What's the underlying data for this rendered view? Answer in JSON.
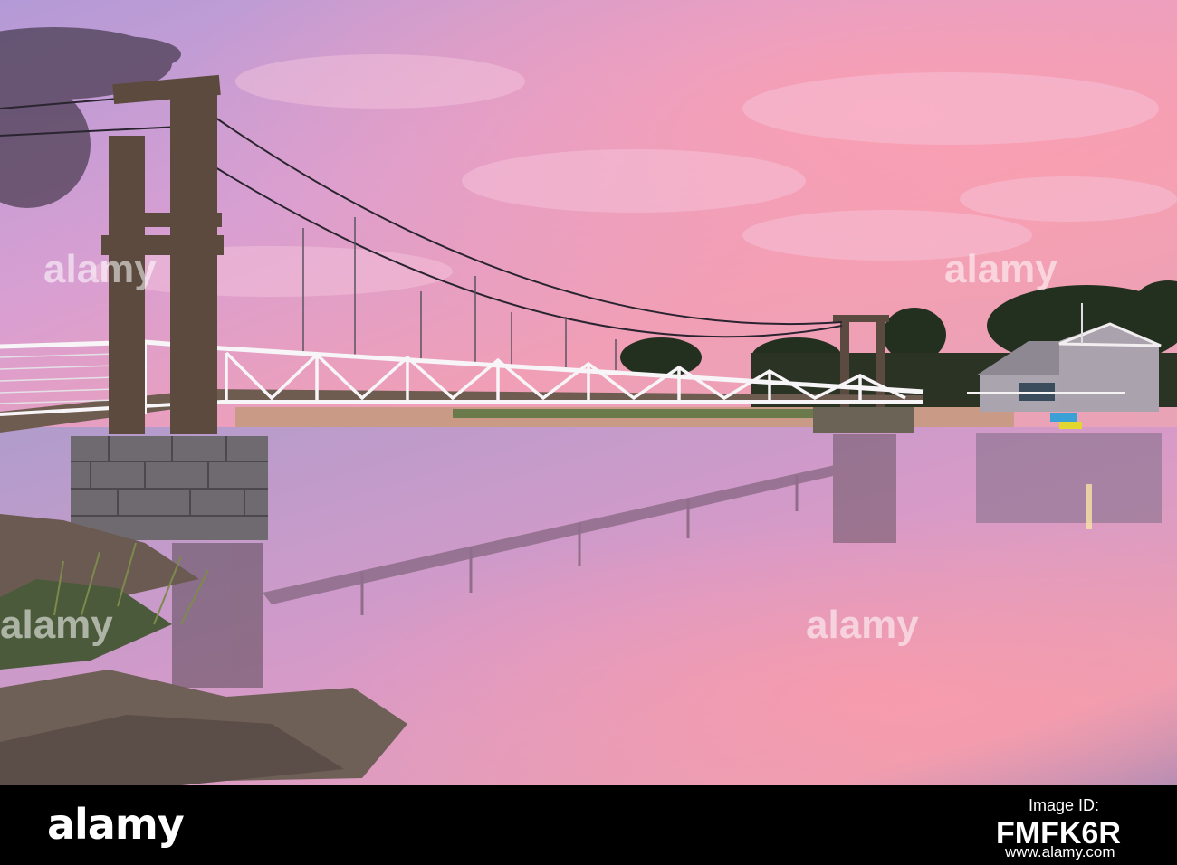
{
  "watermark": {
    "text": "alamy",
    "color": "#ffffff"
  },
  "footer": {
    "brand": "alamy",
    "image_id_label": "Image ID:",
    "image_id": "FMFK6R",
    "website": "www.alamy.com",
    "background": "#000000"
  },
  "scene": {
    "sky_colors": [
      "#c79bd4",
      "#e89ac0",
      "#f39aa3",
      "#b8a1d6"
    ],
    "water_colors": [
      "#c7a3cf",
      "#d99bc9",
      "#e7a0b7",
      "#9b86ae"
    ]
  }
}
